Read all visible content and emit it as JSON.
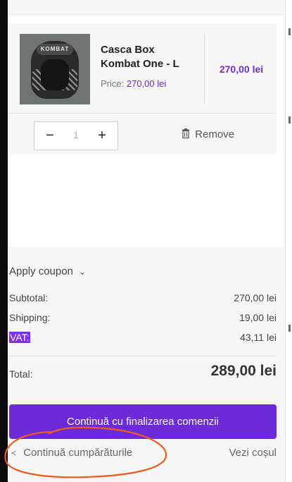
{
  "cart": {
    "item": {
      "image_brand": "KOMBAT",
      "name": "Casca Box Kombat One - L",
      "price_label": "Price:",
      "price_value": "270,00 lei",
      "line_total": "270,00 lei",
      "quantity": "1",
      "minus_symbol": "−",
      "plus_symbol": "+",
      "remove_label": "Remove"
    }
  },
  "summary": {
    "coupon_label": "Apply coupon",
    "subtotal_label": "Subtotal:",
    "subtotal_value": "270,00 lei",
    "shipping_label": "Shipping:",
    "shipping_value": "19,00 lei",
    "vat_label": "VAT:",
    "vat_value": "43,11 lei",
    "total_label": "Total:",
    "total_value": "289,00 lei"
  },
  "actions": {
    "checkout_label": "Continuă cu finalizarea comenzii",
    "continue_label": "Continuă cumpărăturile",
    "view_cart_label": "Vezi coșul"
  },
  "colors": {
    "accent": "#6c2bd9",
    "highlight": "#7b2ff7",
    "annotation": "#f05a1a"
  }
}
